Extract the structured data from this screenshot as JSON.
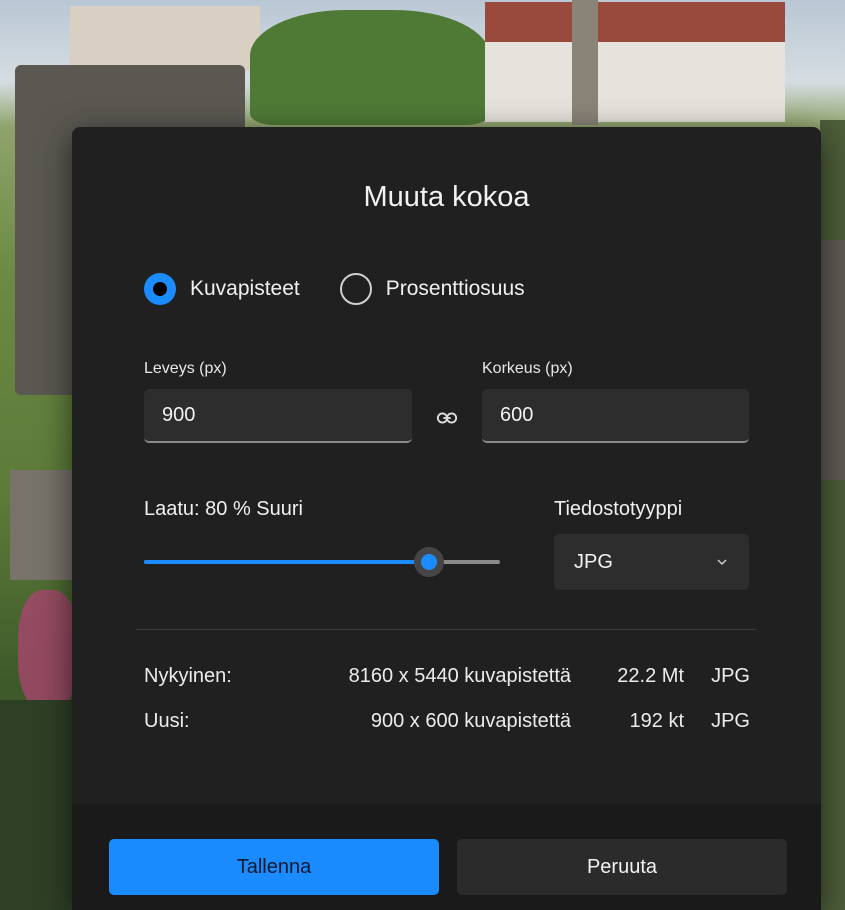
{
  "dialog": {
    "title": "Muuta kokoa",
    "mode": {
      "options": [
        {
          "label": "Kuvapisteet",
          "selected": true
        },
        {
          "label": "Prosenttiosuus",
          "selected": false
        }
      ]
    },
    "width": {
      "label": "Leveys (px)",
      "value": "900"
    },
    "height": {
      "label": "Korkeus (px)",
      "value": "600"
    },
    "aspect_lock_icon": "link-icon",
    "quality": {
      "label": "Laatu: 80 % Suuri",
      "value_percent": 80
    },
    "filetype": {
      "label": "Tiedostotyyppi",
      "selected": "JPG"
    },
    "current": {
      "label": "Nykyinen:",
      "dimensions": "8160 x 5440 kuvapistettä",
      "size": "22.2 Mt",
      "format": "JPG"
    },
    "new": {
      "label": "Uusi:",
      "dimensions": "900 x 600 kuvapistettä",
      "size": "192 kt",
      "format": "JPG"
    },
    "buttons": {
      "save": "Tallenna",
      "cancel": "Peruuta"
    },
    "accent_color": "#1a8cff"
  }
}
